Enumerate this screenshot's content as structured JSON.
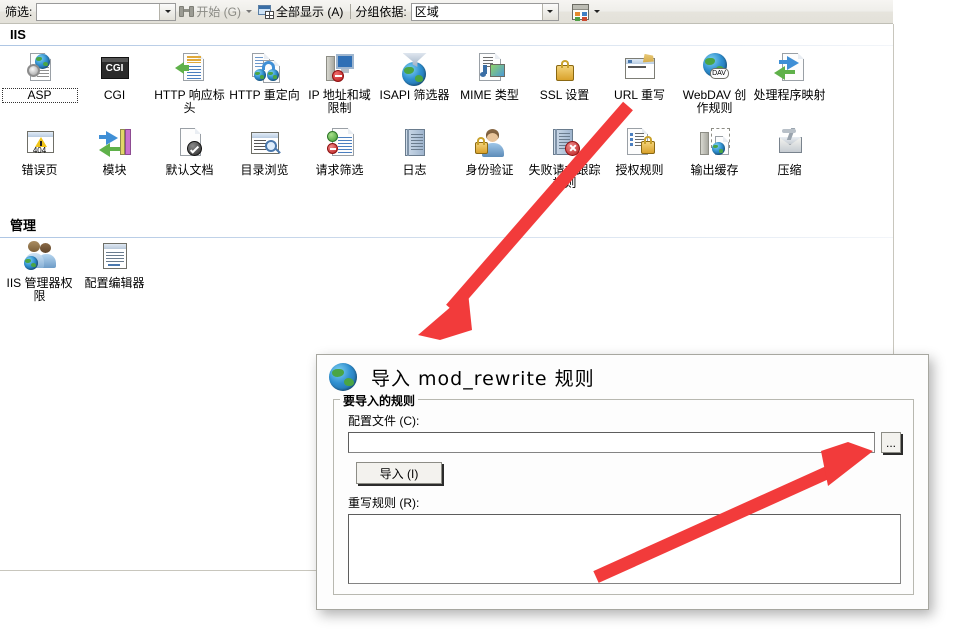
{
  "toolbar": {
    "filter_label": "筛选:",
    "filter_value": "",
    "go_label": "开始 (G)",
    "go_icon": "binoculars-icon",
    "show_all_label": "全部显示 (A)",
    "show_all_icon": "show-all-icon",
    "group_by_label": "分组依据:",
    "group_by_value": "区域",
    "view_icon": "view-mode-icon"
  },
  "sections": [
    {
      "title": "IIS",
      "rows": [
        [
          {
            "label": "ASP",
            "icon": "asp-icon",
            "selected": true
          },
          {
            "label": "CGI",
            "icon": "cgi-icon",
            "selected": false
          },
          {
            "label": "HTTP 响应标头",
            "icon": "http-response-headers-icon",
            "selected": false
          },
          {
            "label": "HTTP 重定向",
            "icon": "http-redirect-icon",
            "selected": false
          },
          {
            "label": "IP 地址和域限制",
            "icon": "ip-address-domain-restrictions-icon",
            "selected": false
          },
          {
            "label": "ISAPI 筛选器",
            "icon": "isapi-filters-icon",
            "selected": false
          },
          {
            "label": "MIME 类型",
            "icon": "mime-types-icon",
            "selected": false
          },
          {
            "label": "SSL 设置",
            "icon": "ssl-settings-icon",
            "selected": false
          },
          {
            "label": "URL 重写",
            "icon": "url-rewrite-icon",
            "selected": false
          },
          {
            "label": "WebDAV 创作规则",
            "icon": "webdav-authoring-rules-icon",
            "selected": false
          },
          {
            "label": "处理程序映射",
            "icon": "handler-mappings-icon",
            "selected": false
          }
        ],
        [
          {
            "label": "错误页",
            "icon": "error-pages-icon",
            "selected": false
          },
          {
            "label": "模块",
            "icon": "modules-icon",
            "selected": false
          },
          {
            "label": "默认文档",
            "icon": "default-document-icon",
            "selected": false
          },
          {
            "label": "目录浏览",
            "icon": "directory-browsing-icon",
            "selected": false
          },
          {
            "label": "请求筛选",
            "icon": "request-filtering-icon",
            "selected": false
          },
          {
            "label": "日志",
            "icon": "logging-icon",
            "selected": false
          },
          {
            "label": "身份验证",
            "icon": "authentication-icon",
            "selected": false
          },
          {
            "label": "失败请求跟踪规则",
            "icon": "failed-request-tracing-rules-icon",
            "selected": false
          },
          {
            "label": "授权规则",
            "icon": "authorization-rules-icon",
            "selected": false
          },
          {
            "label": "输出缓存",
            "icon": "output-caching-icon",
            "selected": false
          },
          {
            "label": "压缩",
            "icon": "compression-icon",
            "selected": false
          }
        ]
      ]
    },
    {
      "title": "管理",
      "rows": [
        [
          {
            "label": "IIS 管理器权限",
            "icon": "iis-manager-permissions-icon",
            "selected": false
          },
          {
            "label": "配置编辑器",
            "icon": "configuration-editor-icon",
            "selected": false
          }
        ]
      ]
    }
  ],
  "dialog": {
    "icon": "globe-icon",
    "title": "导入 mod_rewrite 规则",
    "group_legend": "要导入的规则",
    "config_file_label": "配置文件 (C):",
    "config_file_value": "",
    "browse_label": "...",
    "import_button_label": "导入 (I)",
    "rewrite_rules_label": "重写规则 (R):",
    "rewrite_rules_value": ""
  },
  "annotations": {
    "accent_color": "#f23b3b",
    "arrow_1": "arrow-pointing-to-dialog",
    "arrow_2": "arrow-pointing-to-browse-button"
  }
}
